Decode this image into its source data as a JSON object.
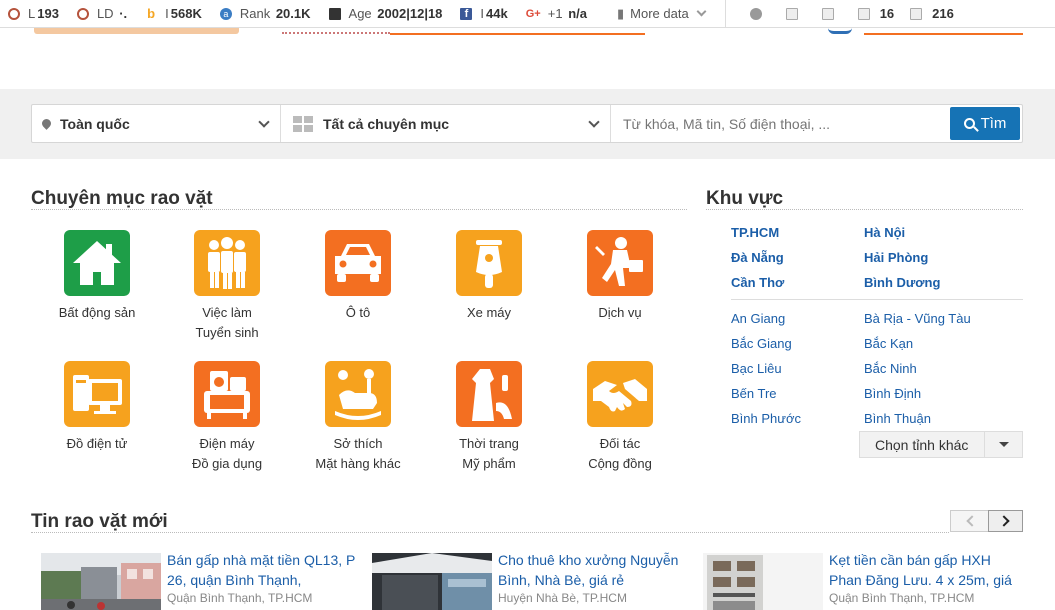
{
  "seobar": {
    "items": [
      {
        "icon": "ring-icon",
        "label": "L",
        "value": "193"
      },
      {
        "icon": "ring-icon",
        "label": "LD",
        "value": "·."
      },
      {
        "icon": "bing-icon",
        "label": "I",
        "value": "568K"
      },
      {
        "icon": "rank-icon",
        "label": "Rank",
        "value": "20.1K"
      },
      {
        "icon": "calendar-icon",
        "label": "Age",
        "value": "2002|12|18"
      },
      {
        "icon": "facebook-icon",
        "label": "I",
        "value": "44k"
      },
      {
        "icon": "google-plus-icon",
        "label": "+1",
        "value": "n/a"
      }
    ],
    "more_data": "More data",
    "links_in": "16",
    "links_out": "216"
  },
  "search": {
    "location": "Toàn quốc",
    "category": "Tất cả chuyên mục",
    "placeholder": "Từ khóa, Mã tin, Số điện thoại, ...",
    "button": "Tìm"
  },
  "categories": {
    "title": "Chuyên mục rao vặt",
    "items": [
      {
        "name": "Bất động sản",
        "line2": "",
        "color": "#1e9e48",
        "icon": "house-icon"
      },
      {
        "name": "Việc làm",
        "line2": "Tuyển sinh",
        "color": "#f6a21e",
        "icon": "people-icon"
      },
      {
        "name": "Ô tô",
        "line2": "",
        "color": "#f36f21",
        "icon": "car-icon"
      },
      {
        "name": "Xe máy",
        "line2": "",
        "color": "#f6a21e",
        "icon": "scooter-icon"
      },
      {
        "name": "Dịch vụ",
        "line2": "",
        "color": "#f36f21",
        "icon": "service-man-icon"
      },
      {
        "name": "Đồ điện tử",
        "line2": "",
        "color": "#f6a21e",
        "icon": "computer-icon"
      },
      {
        "name": "Điện máy",
        "line2": "Đồ gia dụng",
        "color": "#f36f21",
        "icon": "appliances-icon"
      },
      {
        "name": "Sở thích",
        "line2": "Mặt hàng khác",
        "color": "#f6a21e",
        "icon": "hobby-icon"
      },
      {
        "name": "Thời trang",
        "line2": "Mỹ phẩm",
        "color": "#f36f21",
        "icon": "fashion-icon"
      },
      {
        "name": "Đối tác",
        "line2": "Cộng đồng",
        "color": "#f6a21e",
        "icon": "handshake-icon"
      }
    ]
  },
  "regions": {
    "title": "Khu vực",
    "major": [
      "TP.HCM",
      "Hà Nội",
      "Đà Nẵng",
      "Hải Phòng",
      "Cần Thơ",
      "Bình Dương"
    ],
    "minor": [
      "An Giang",
      "Bà Rịa - Vũng Tàu",
      "Bắc Giang",
      "Bắc Kạn",
      "Bạc Liêu",
      "Bắc Ninh",
      "Bến Tre",
      "Bình Định",
      "Bình Phước",
      "Bình Thuận"
    ],
    "other": "Chọn tỉnh khác"
  },
  "news": {
    "title": "Tin rao vặt mới",
    "items": [
      {
        "title": "Bán gấp nhà mặt tiền QL13, P 26, quận Bình Thạnh,",
        "location": "Quận Bình Thạnh, TP.HCM"
      },
      {
        "title": "Cho thuê kho xưởng Nguyễn Bình, Nhà Bè, giá rẻ",
        "location": "Huyện Nhà Bè, TP.HCM"
      },
      {
        "title": "Kẹt tiền cần bán gấp HXH Phan Đăng Lưu. 4 x 25m, giá",
        "location": "Quận Bình Thạnh, TP.HCM"
      }
    ]
  }
}
